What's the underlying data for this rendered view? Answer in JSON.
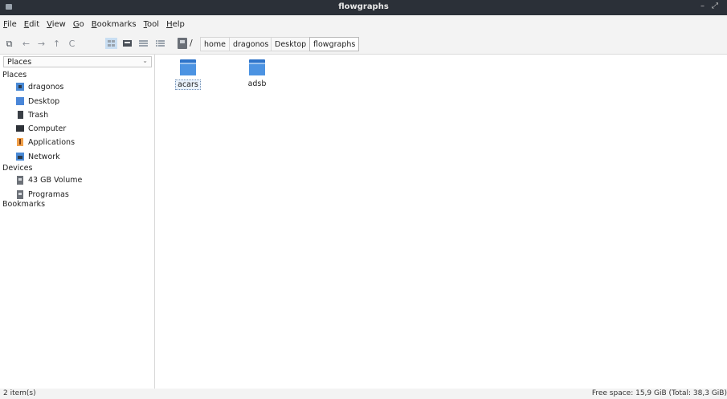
{
  "window": {
    "title": "flowgraphs",
    "controls": [
      "–",
      "⤢"
    ]
  },
  "menubar": [
    {
      "accel": "F",
      "rest": "ile"
    },
    {
      "accel": "E",
      "rest": "dit"
    },
    {
      "accel": "V",
      "rest": "iew"
    },
    {
      "accel": "G",
      "rest": "o"
    },
    {
      "accel": "B",
      "rest": "ookmarks"
    },
    {
      "accel": "T",
      "rest": "ool"
    },
    {
      "accel": "H",
      "rest": "elp"
    }
  ],
  "toolbar": {
    "buttons": [
      {
        "name": "new-tab-icon",
        "glyph": "⧉"
      },
      {
        "name": "back-icon",
        "glyph": "←"
      },
      {
        "name": "forward-icon",
        "glyph": "→"
      },
      {
        "name": "up-icon",
        "glyph": "↑"
      },
      {
        "name": "reload-icon",
        "glyph": "C"
      }
    ],
    "path_root": "/",
    "breadcrumbs": [
      "home",
      "dragonos",
      "Desktop",
      "flowgraphs"
    ]
  },
  "sidebar": {
    "dropdown_value": "Places",
    "dropdown_arrow": "⌄",
    "sections": {
      "places": "Places",
      "devices": "Devices",
      "bookmarks": "Bookmarks"
    },
    "places": [
      {
        "label": "dragonos",
        "icon": "home-folder-icon"
      },
      {
        "label": "Desktop",
        "icon": "desktop-icon"
      },
      {
        "label": "Trash",
        "icon": "trash-icon"
      },
      {
        "label": "Computer",
        "icon": "computer-icon"
      },
      {
        "label": "Applications",
        "icon": "applications-icon"
      },
      {
        "label": "Network",
        "icon": "network-icon"
      }
    ],
    "devices": [
      {
        "label": "43 GB Volume",
        "icon": "drive-icon"
      },
      {
        "label": "Programas",
        "icon": "drive-icon"
      }
    ]
  },
  "files": [
    {
      "name": "acars",
      "icon": "folder-icon",
      "selected": true
    },
    {
      "name": "adsb",
      "icon": "folder-icon",
      "selected": false
    }
  ],
  "status": {
    "items": "2 item(s)",
    "free_space": "Free space: 15,9 GiB (Total: 38,3 GiB)"
  },
  "colors": {
    "titlebar": "#2b3038",
    "folder": "#4c93e2",
    "selection": "#eaf2fb"
  }
}
